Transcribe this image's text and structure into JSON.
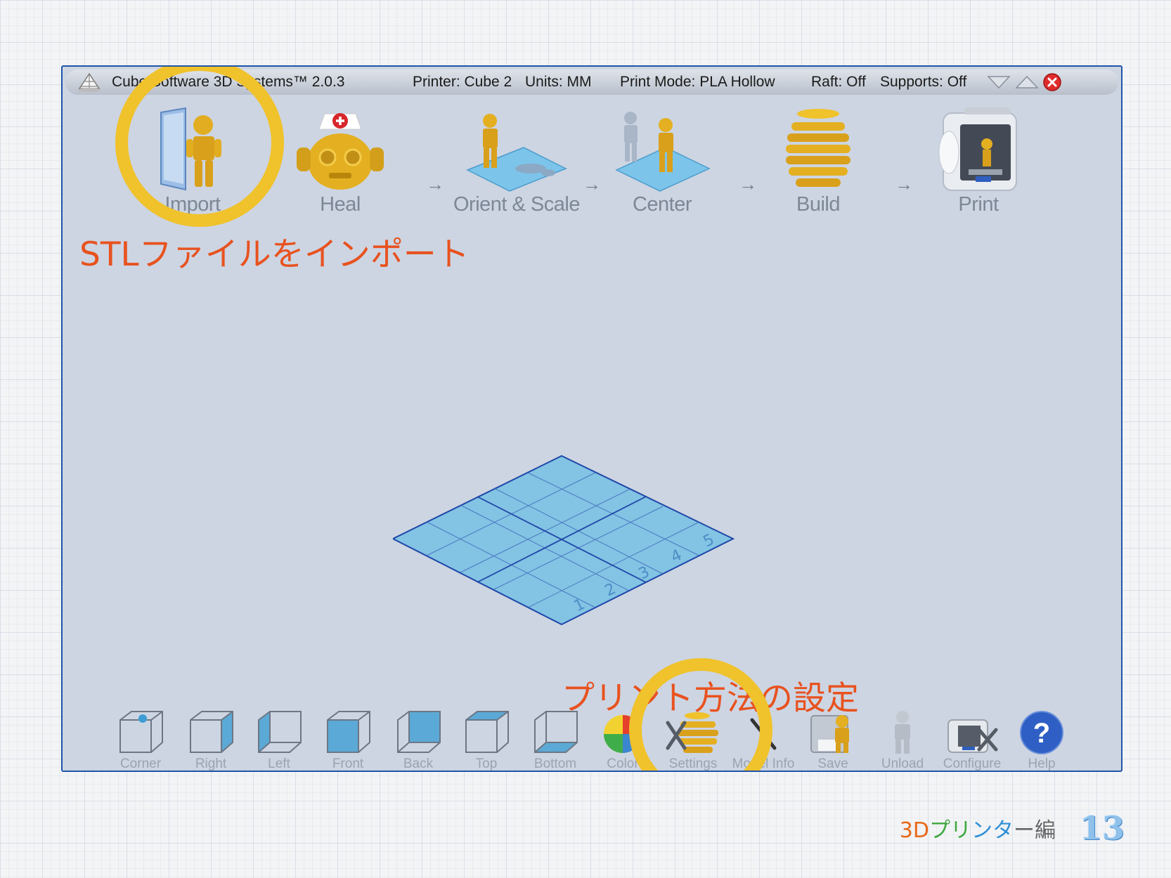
{
  "titlebar": {
    "app": "Cube Software 3D Systems™ 2.0.3",
    "printer": "Printer: Cube 2",
    "units": "Units: MM",
    "print_mode": "Print Mode: PLA Hollow",
    "raft": "Raft: Off",
    "supports": "Supports: Off"
  },
  "steps": [
    {
      "label": "Import",
      "icon": "folder-robot-icon"
    },
    {
      "label": "Heal",
      "icon": "nurse-robot-head-icon"
    },
    {
      "label": "Orient & Scale",
      "icon": "robots-on-plate-icon"
    },
    {
      "label": "Center",
      "icon": "centered-robot-icon"
    },
    {
      "label": "Build",
      "icon": "sliced-layers-icon"
    },
    {
      "label": "Print",
      "icon": "cube-printer-icon"
    }
  ],
  "step_arrow": "→",
  "annotations": {
    "import_note": "STLファイルをインポート",
    "settings_note": "プリント方法の設定"
  },
  "plate_numbers": [
    "1",
    "2",
    "3",
    "4",
    "5"
  ],
  "toolbar": [
    {
      "label": "Corner",
      "icon": "corner-view-icon"
    },
    {
      "label": "Right",
      "icon": "right-view-icon"
    },
    {
      "label": "Left",
      "icon": "left-view-icon"
    },
    {
      "label": "Front",
      "icon": "front-view-icon"
    },
    {
      "label": "Back",
      "icon": "back-view-icon"
    },
    {
      "label": "Top",
      "icon": "top-view-icon"
    },
    {
      "label": "Bottom",
      "icon": "bottom-view-icon"
    },
    {
      "label": "Color",
      "icon": "color-wheel-icon"
    },
    {
      "label": "Settings",
      "icon": "settings-tools-icon"
    },
    {
      "label": "Model Info",
      "icon": "model-info-icon"
    },
    {
      "label": "Save",
      "icon": "save-disk-icon"
    },
    {
      "label": "Unload",
      "icon": "unload-robot-icon"
    },
    {
      "label": "Configure",
      "icon": "configure-printer-icon"
    },
    {
      "label": "Help",
      "icon": "help-question-icon"
    }
  ],
  "footer": {
    "section": "3Dプリンター編",
    "page_number": "13"
  },
  "colors": {
    "window_bg": "#cdd5e2",
    "window_border": "#1f55a8",
    "accent_yellow": "#f0c22b",
    "annotation_orange": "#e8521f",
    "plate_blue": "#83c3e4"
  }
}
